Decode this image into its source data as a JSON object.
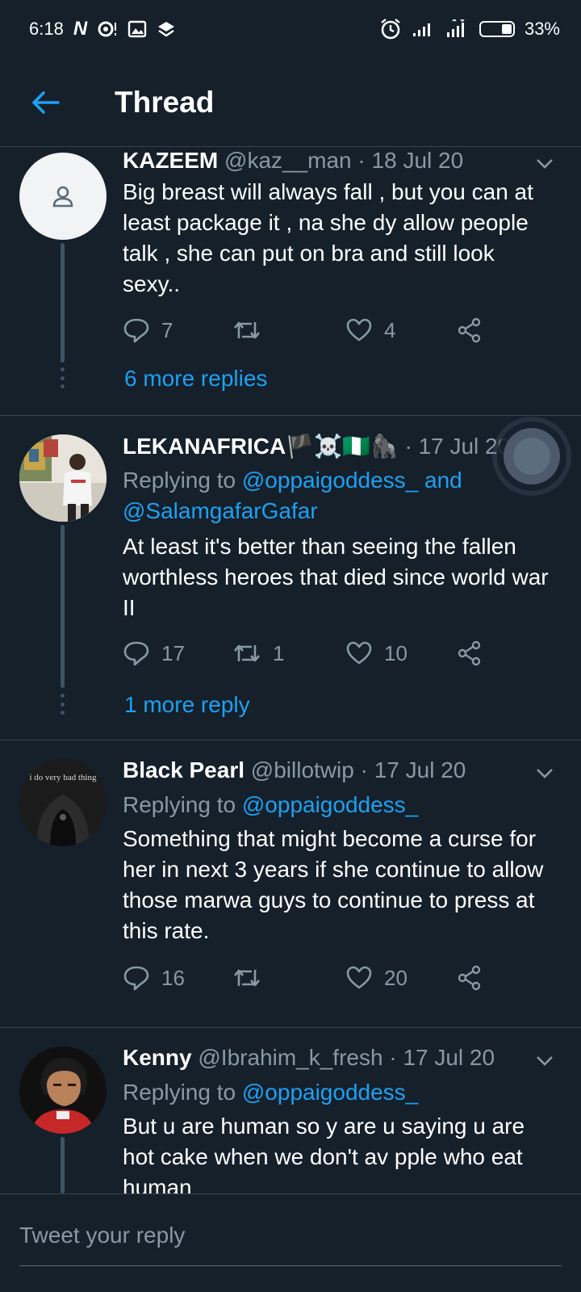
{
  "status_bar": {
    "time": "6:18",
    "battery_percent": "33%",
    "battery_level": 0.33,
    "icons_left": [
      "n-app-icon",
      "notification-icon",
      "image-icon",
      "layers-icon"
    ],
    "icons_right": [
      "alarm-icon",
      "signal-icon",
      "signal-icon",
      "battery-icon"
    ]
  },
  "header": {
    "title": "Thread"
  },
  "tweets": [
    {
      "name": "KAZEEM",
      "handle": "@kaz__man",
      "separator": "·",
      "date": "18 Jul 20",
      "body": "Big breast will always fall , but you can at least package it , na she dy allow people talk , she can put on bra and still look sexy..",
      "replies": "7",
      "retweets": "",
      "likes": "4",
      "more_replies": "6 more replies"
    },
    {
      "name": "LEKANAFRICA",
      "name_emoji": "🏴☠️🇳🇬🦍",
      "handle": "",
      "separator": "·",
      "date": "17 Jul 20",
      "replying_prefix": "Replying to",
      "replying_to": "@oppaigoddess_ and @SalamgafarGafar",
      "body": "At least it's better than seeing the fallen worthless heroes that died since world war II",
      "replies": "17",
      "retweets": "1",
      "likes": "10",
      "more_replies": "1 more reply"
    },
    {
      "name": "Black Pearl",
      "handle": "@billotwip",
      "separator": "·",
      "date": "17 Jul 20",
      "replying_prefix": "Replying to",
      "replying_to": "@oppaigoddess_",
      "body": "Something that might become a curse for her in next 3 years if she continue to allow those marwa guys to continue to press at this rate.",
      "replies": "16",
      "retweets": "",
      "likes": "20",
      "avatar_text": "i do very bad thing"
    },
    {
      "name": "Kenny",
      "handle": "@Ibrahim_k_fresh",
      "separator": "·",
      "date": "17 Jul 20",
      "replying_prefix": "Replying to",
      "replying_to": "@oppaigoddess_",
      "body": "But u are human so y are u saying u are hot cake when we don't av pple who eat human"
    }
  ],
  "reply_bar": {
    "placeholder": "Tweet your reply"
  },
  "colors": {
    "background": "#15202b",
    "accent": "#1da1f2",
    "muted": "#8899a6",
    "divider": "#38444d"
  }
}
